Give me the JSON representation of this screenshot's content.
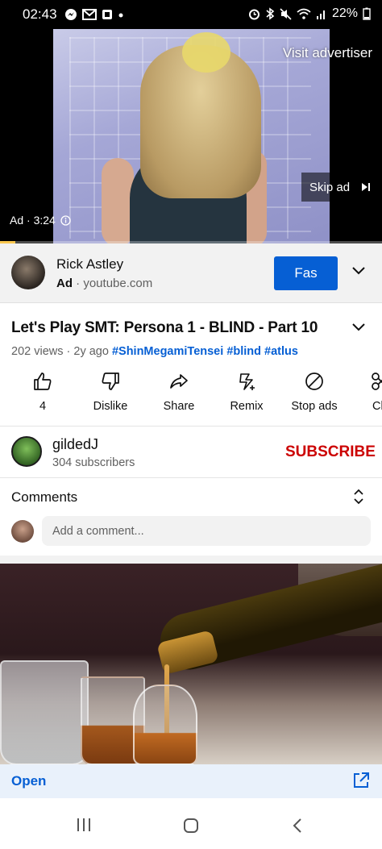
{
  "status_bar": {
    "time": "02:43",
    "battery": "22%",
    "left_icons": [
      "messenger-icon",
      "gmail-icon",
      "app-icon",
      "dot-icon"
    ],
    "right_icons": [
      "alarm-icon",
      "bluetooth-icon",
      "mute-icon",
      "wifi-icon",
      "signal-icon",
      "battery-icon"
    ]
  },
  "video": {
    "visit_advertiser": "Visit advertiser",
    "skip_ad": "Skip ad",
    "ad_time": "Ad · 3:24",
    "progress": 0.04,
    "progress_color": "#f9c74f"
  },
  "ad_bar": {
    "name": "Rick Astley",
    "ad_label": "Ad",
    "domain": "youtube.com",
    "button": "Fas",
    "button_color": "#065fd4"
  },
  "video_info": {
    "title": "Let's Play SMT: Persona 1 - BLIND - Part 10",
    "views": "202 views",
    "age": "2y ago",
    "tags": [
      "#ShinMegamiTensei",
      "#blind",
      "#atlus"
    ]
  },
  "actions": [
    {
      "label": "4",
      "icon": "like-icon"
    },
    {
      "label": "Dislike",
      "icon": "dislike-icon"
    },
    {
      "label": "Share",
      "icon": "share-icon"
    },
    {
      "label": "Remix",
      "icon": "remix-icon"
    },
    {
      "label": "Stop ads",
      "icon": "stop-ads-icon"
    },
    {
      "label": "Cl",
      "icon": "clip-icon"
    }
  ],
  "channel": {
    "name": "gildedJ",
    "subscribers": "304 subscribers",
    "subscribe": "SUBSCRIBE",
    "subscribe_color": "#cc0000"
  },
  "comments": {
    "title": "Comments",
    "placeholder": "Add a comment..."
  },
  "bottom_ad": {
    "open": "Open"
  },
  "nav": [
    "recents-icon",
    "home-icon",
    "back-icon"
  ]
}
